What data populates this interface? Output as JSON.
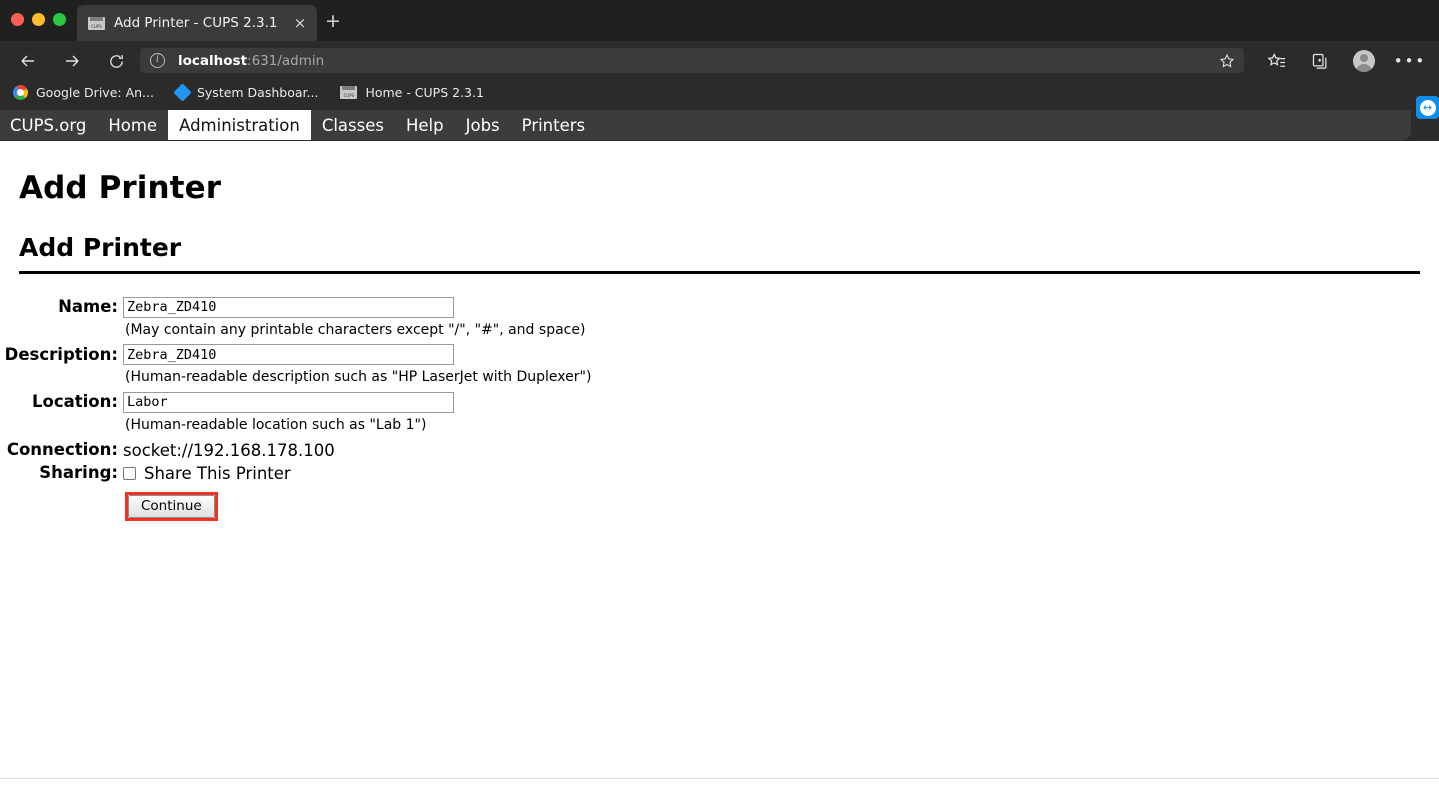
{
  "window": {
    "traffic_lights": [
      {
        "name": "close",
        "color": "#ff5f57"
      },
      {
        "name": "minimize",
        "color": "#febc2e"
      },
      {
        "name": "zoom",
        "color": "#28c840"
      }
    ]
  },
  "browser": {
    "tab": {
      "title": "Add Printer - CUPS 2.3.1",
      "favicon": "cups-icon",
      "close_label": "×"
    },
    "new_tab_label": "+",
    "nav": {
      "back": "back-arrow-icon",
      "forward": "forward-arrow-icon",
      "reload": "reload-icon"
    },
    "omnibox": {
      "info_icon": "ı",
      "host": "localhost",
      "rest": ":631/admin",
      "full_url": "localhost:631/admin"
    },
    "toolbar": {
      "star": "favorite-star-icon",
      "favorites": "favorites-list-icon",
      "collections": "collections-icon",
      "profile": "profile-avatar-icon",
      "settings": "•••"
    },
    "bookmarks": [
      {
        "label": "Google Drive: An...",
        "icon": "google-drive-icon"
      },
      {
        "label": "System Dashboar...",
        "icon": "blue-diamond-icon"
      },
      {
        "label": "Home - CUPS 2.3.1",
        "icon": "cups-icon"
      }
    ]
  },
  "teamviewer": {
    "icon_glyph": "↔",
    "color": "#0e8ee9"
  },
  "cups_nav": [
    {
      "label": "CUPS.org",
      "active": false
    },
    {
      "label": "Home",
      "active": false
    },
    {
      "label": "Administration",
      "active": true
    },
    {
      "label": "Classes",
      "active": false
    },
    {
      "label": "Help",
      "active": false
    },
    {
      "label": "Jobs",
      "active": false
    },
    {
      "label": "Printers",
      "active": false
    }
  ],
  "page": {
    "h1": "Add Printer",
    "h2": "Add Printer",
    "fields": {
      "name": {
        "label": "Name:",
        "value": "Zebra_ZD410",
        "help": "(May contain any printable characters except \"/\", \"#\", and space)"
      },
      "description": {
        "label": "Description:",
        "value": "Zebra_ZD410",
        "help": "(Human-readable description such as \"HP LaserJet with Duplexer\")"
      },
      "location": {
        "label": "Location:",
        "value": "Labor",
        "help": "(Human-readable location such as \"Lab 1\")"
      },
      "connection": {
        "label": "Connection:",
        "value": "socket://192.168.178.100"
      },
      "sharing": {
        "label": "Sharing:",
        "checkbox_label": "Share This Printer",
        "checked": false
      }
    },
    "continue_button": {
      "label": "Continue",
      "highlight_color": "#ee3322"
    }
  }
}
